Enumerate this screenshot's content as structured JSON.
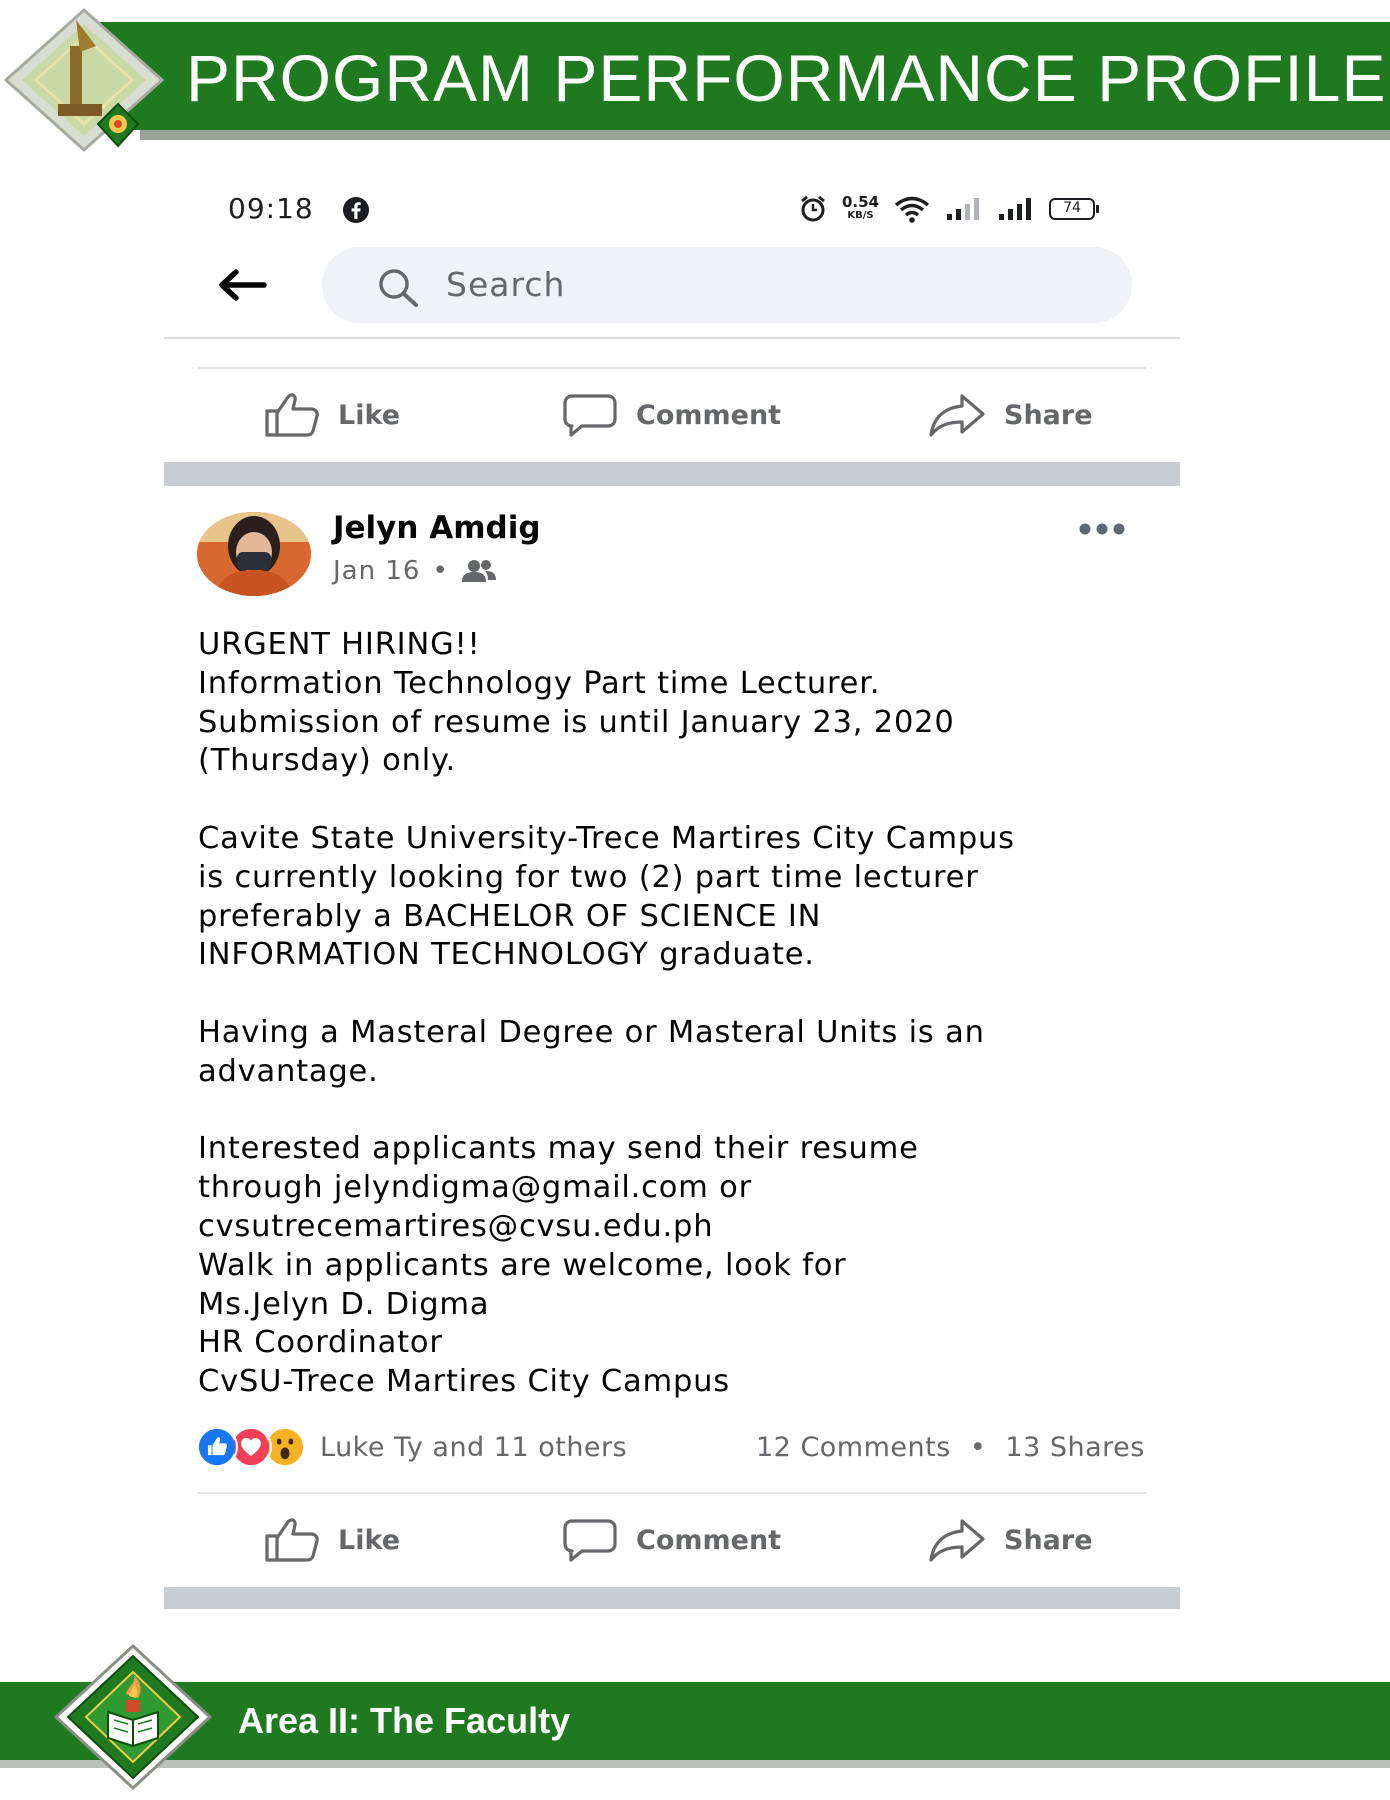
{
  "header": {
    "title": "PROGRAM PERFORMANCE PROFILE"
  },
  "status_bar": {
    "time": "09:18",
    "net_speed_value": "0.54",
    "net_speed_unit": "KB/S",
    "battery": "74"
  },
  "search": {
    "placeholder": "Search"
  },
  "actions": {
    "like": "Like",
    "comment": "Comment",
    "share": "Share"
  },
  "post": {
    "author": "Jelyn Amdig",
    "date": "Jan 16",
    "audience_icon": "friends-icon",
    "body": {
      "p1": [
        "URGENT HIRING!!",
        "Information Technology Part time Lecturer.",
        "Submission of resume is until January 23, 2020",
        "(Thursday) only."
      ],
      "p2": [
        "Cavite State University-Trece Martires City Campus",
        "is currently looking for two (2) part time lecturer",
        "preferably a BACHELOR OF SCIENCE IN",
        "INFORMATION TECHNOLOGY graduate."
      ],
      "p3": [
        "Having a Masteral Degree or Masteral Units is an",
        "advantage."
      ],
      "p4": [
        "Interested applicants may send their resume",
        "through jelyndigma@gmail.com or",
        "cvsutrecemartires@cvsu.edu.ph",
        "Walk in applicants are welcome, look for",
        "Ms.Jelyn D. Digma",
        "HR Coordinator",
        "CvSU-Trece Martires City Campus"
      ]
    },
    "reactions": {
      "icons": [
        "like-reaction-icon",
        "love-reaction-icon",
        "wow-reaction-icon"
      ],
      "summary": "Luke Ty and 11 others"
    },
    "engagement": {
      "comments": "12 Comments",
      "separator": "•",
      "shares": "13 Shares"
    }
  },
  "footer": {
    "title": "Area II: The Faculty"
  },
  "colors": {
    "band_green": "#1f7a1f",
    "facebook_gray_text": "#65676b",
    "like_blue": "#1877f2",
    "love_red": "#f33e58",
    "wow_yellow": "#f7b125"
  }
}
